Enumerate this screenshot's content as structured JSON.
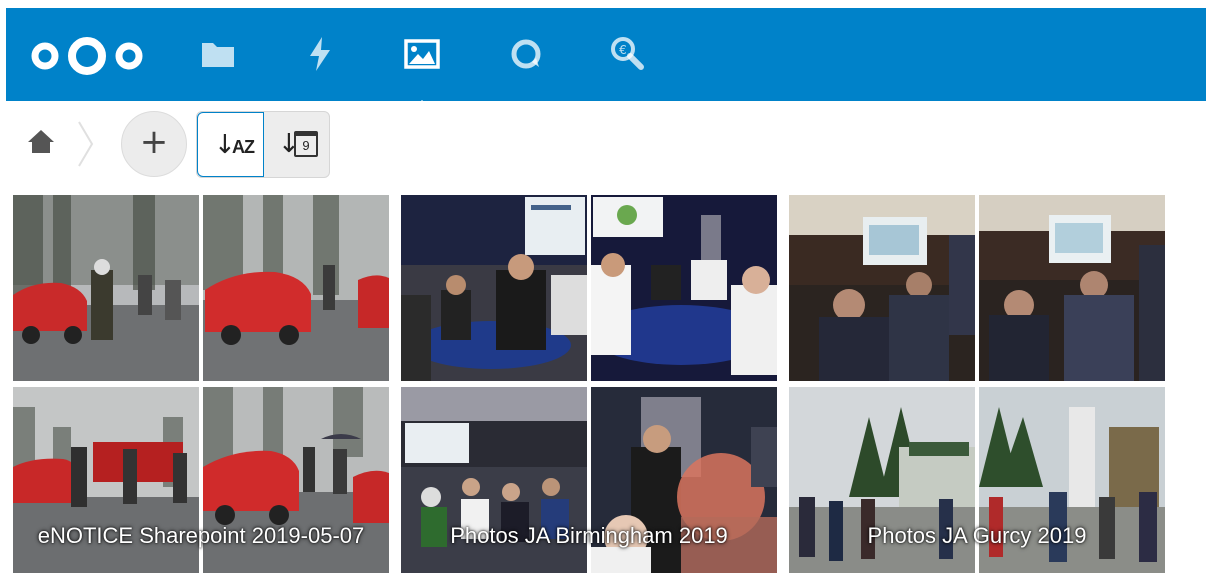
{
  "header": {
    "brand": "Nextcloud",
    "accent": "#0082c9",
    "apps": [
      {
        "name": "Files",
        "icon": "folder-icon"
      },
      {
        "name": "Activity",
        "icon": "lightning-icon"
      },
      {
        "name": "Gallery",
        "icon": "image-icon",
        "active": true
      },
      {
        "name": "Talk",
        "icon": "chat-bubble-icon"
      },
      {
        "name": "Search",
        "icon": "search-icon"
      }
    ]
  },
  "toolbar": {
    "home_icon": "home-icon",
    "add_label": "+",
    "sort_name_label": "AZ",
    "sort_date_label": "9",
    "sort_active": "name"
  },
  "albums": [
    {
      "title": "eNOTICE Sharepoint 2019-05-07",
      "thumbnails": 4
    },
    {
      "title": "Photos JA Birmingham 2019",
      "thumbnails": 4
    },
    {
      "title": "Photos JA Gurcy 2019",
      "thumbnails": 4
    }
  ]
}
